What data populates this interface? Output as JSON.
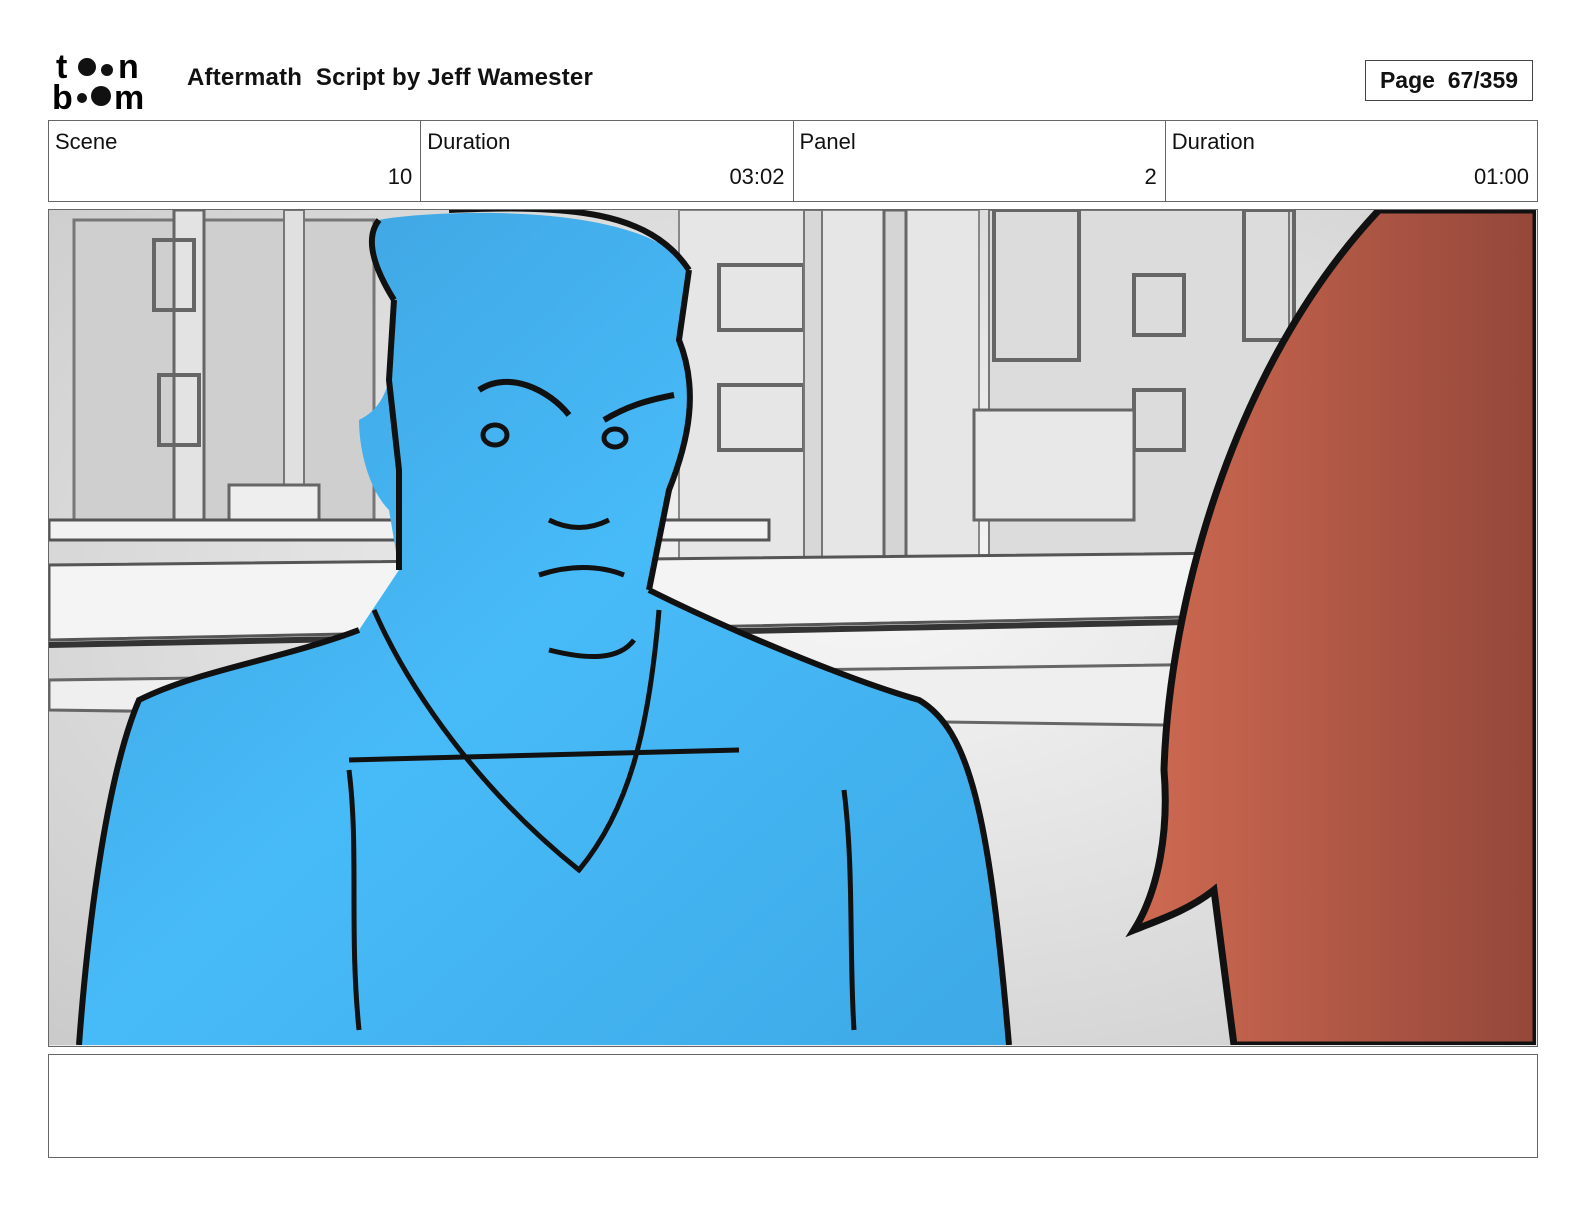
{
  "header": {
    "logo_text": "toon boom",
    "title": "Aftermath  Script by Jeff Wamester",
    "page_label": "Page  67/359"
  },
  "info": [
    {
      "label": "Scene",
      "value": "10"
    },
    {
      "label": "Duration",
      "value": "03:02"
    },
    {
      "label": "Panel",
      "value": "2"
    },
    {
      "label": "Duration",
      "value": "01:00"
    }
  ],
  "panel": {
    "description": "",
    "colors": {
      "character": "#45b8f5",
      "foreground_figure": "#b85a45",
      "background": "#e5e5e5",
      "ink": "#111111"
    }
  },
  "notes": ""
}
